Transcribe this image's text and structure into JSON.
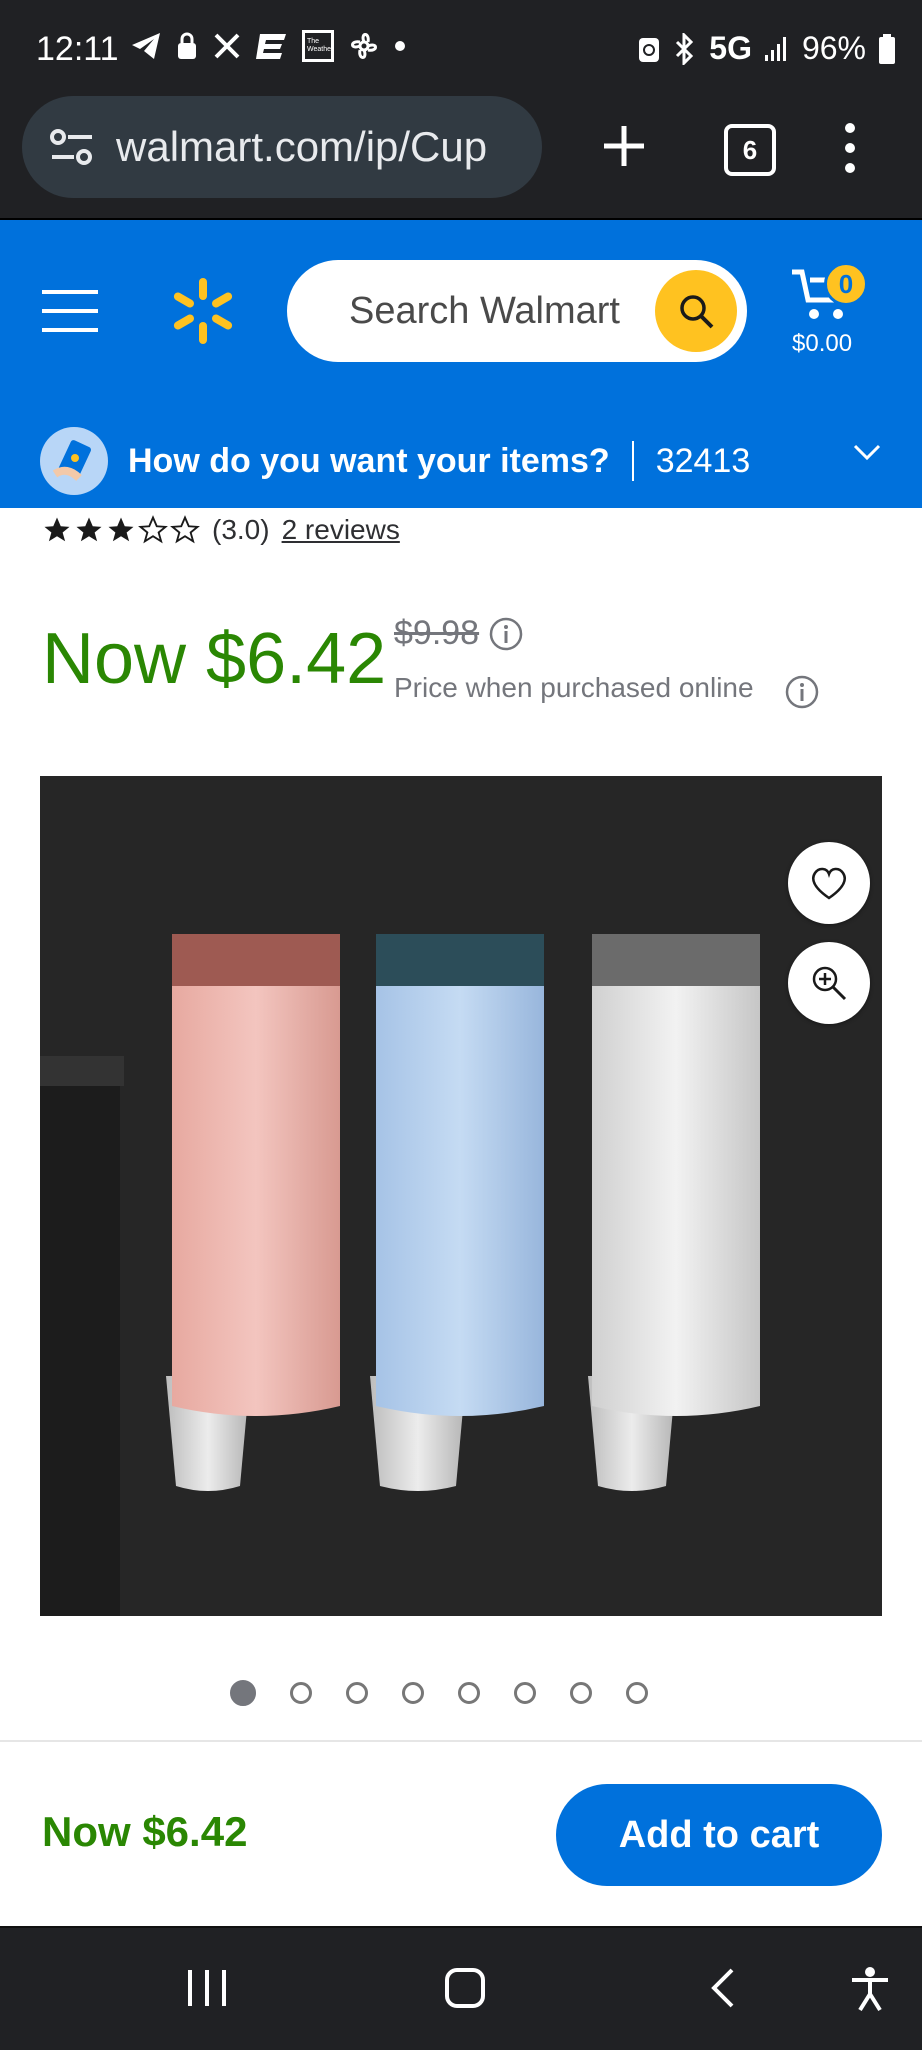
{
  "status_bar": {
    "time": "12:11",
    "network": "5G",
    "battery": "96%"
  },
  "browser": {
    "url": "walmart.com/ip/Cup",
    "tab_count": "6"
  },
  "header": {
    "search_placeholder": "Search Walmart",
    "cart_count": "0",
    "cart_total": "$0.00",
    "delivery_question": "How do you want your items?",
    "zip": "32413",
    "brand_color": "#0071dc",
    "accent_color": "#ffc220"
  },
  "product": {
    "rating_value": 3.0,
    "rating_text": "(3.0)",
    "reviews_link": "2 reviews",
    "now_price": "Now $6.42",
    "was_price": "$9.98",
    "price_note": "Price when purchased online",
    "image_count": 8,
    "active_image_index": 0
  },
  "bottom_bar": {
    "price": "Now $6.42",
    "add_to_cart_label": "Add to cart"
  },
  "icons": [
    "telegram-icon",
    "lock-icon",
    "tools-icon",
    "e-icon",
    "weather-channel-icon",
    "fan-icon",
    "dot-icon",
    "battery-saver-icon",
    "bluetooth-icon",
    "signal-icon",
    "battery-icon",
    "site-settings-icon",
    "plus-icon",
    "tabs-icon",
    "more-menu-icon",
    "hamburger-icon",
    "walmart-spark-icon",
    "search-icon",
    "cart-icon",
    "delivery-icon",
    "chevron-down-icon",
    "star-icon",
    "info-icon",
    "heart-icon",
    "zoom-in-icon",
    "recents-icon",
    "home-icon",
    "back-icon",
    "accessibility-icon"
  ]
}
